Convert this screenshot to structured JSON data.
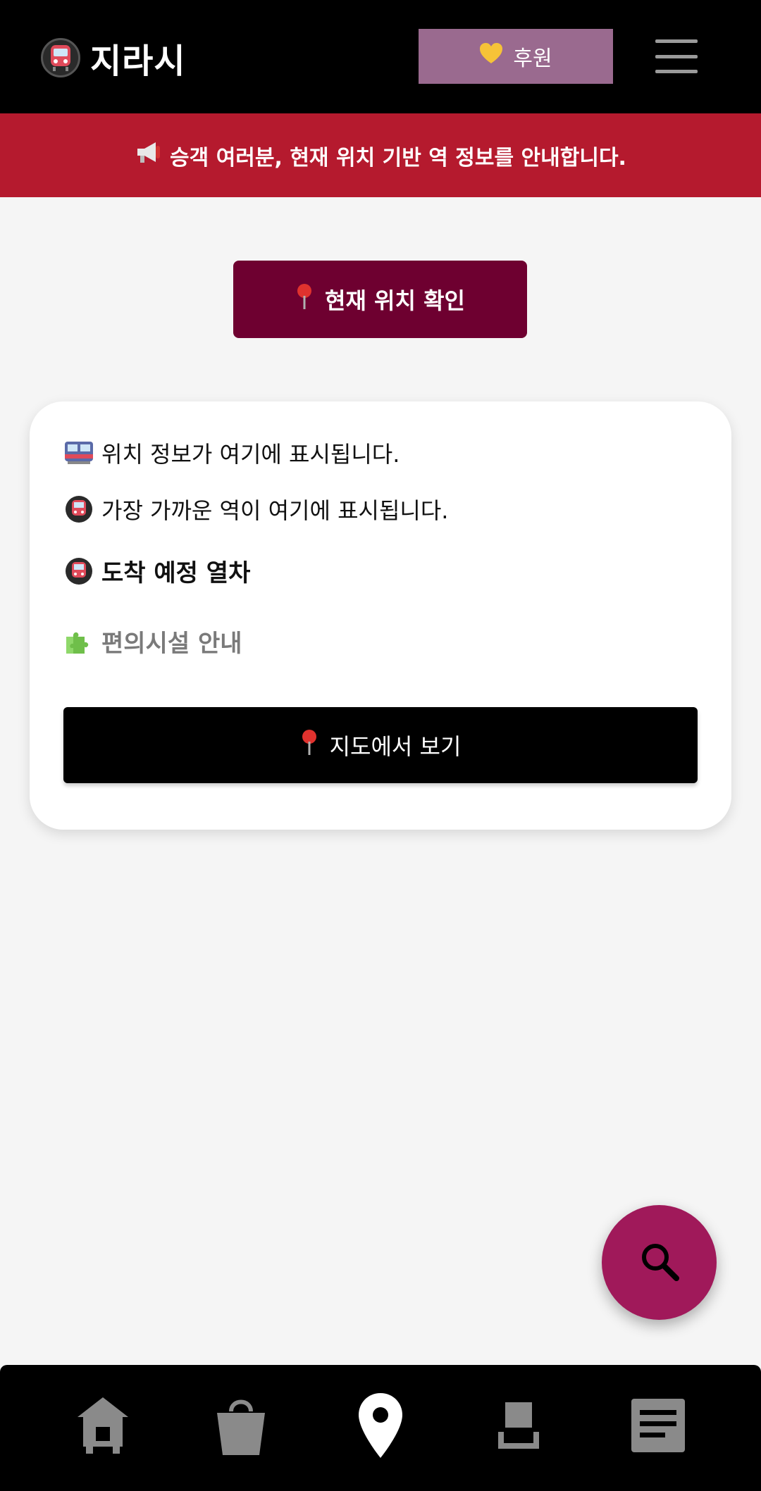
{
  "header": {
    "title": "지라시",
    "donate_label": "후원"
  },
  "notice": {
    "text": "승객 여러분, 현재 위치 기반 역 정보를 안내합니다."
  },
  "location_button": {
    "label": "현재 위치 확인"
  },
  "card": {
    "location_text": "위치 정보가 여기에 표시됩니다.",
    "nearest_station_text": "가장 가까운 역이 여기에 표시됩니다.",
    "arrivals_title": "도착 예정 열차",
    "facilities_title": "편의시설 안내",
    "map_button_label": "지도에서 보기"
  },
  "bottom_nav": {
    "items": [
      {
        "icon": "home-icon",
        "active": false
      },
      {
        "icon": "shopping-bag-icon",
        "active": false
      },
      {
        "icon": "location-pin-icon",
        "active": true
      },
      {
        "icon": "stamp-icon",
        "active": false
      },
      {
        "icon": "article-icon",
        "active": false
      }
    ]
  },
  "colors": {
    "header_bg": "#000000",
    "donate_bg": "#9a6a8f",
    "notice_bg": "#b51a2e",
    "primary_button": "#6e0030",
    "fab_bg": "#a0195a",
    "nav_inactive": "#8a8a8a",
    "nav_active": "#ffffff"
  }
}
